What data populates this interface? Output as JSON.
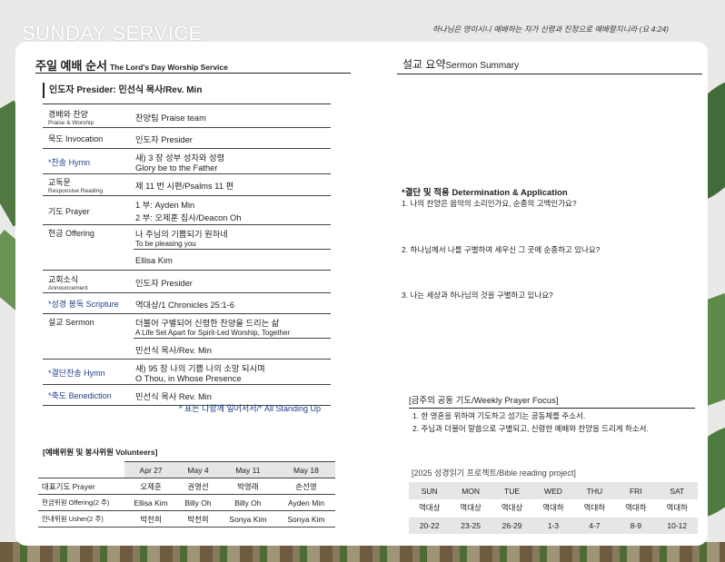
{
  "header": {
    "title": "SUNDAY SERVICE",
    "verse": "하나님은 영이시니 예배하는 자가 신령과 진정으로 예배할지니라 (요 4:24)"
  },
  "order": {
    "title": "주일 예배 순서",
    "title_en": "The Lord's Day Worship Service",
    "presider": "인도자 Presider: 민선식 목사/Rev. Min",
    "rows": [
      {
        "label": "경배와 찬양",
        "sub": "Praise & Worship",
        "value": "찬양팀 Praise team"
      },
      {
        "label": "묵도 Invocation",
        "value": "인도자 Presider"
      },
      {
        "label": "*찬송 Hymn",
        "value": "새) 3 장 성부 성자와 성령",
        "value2": "Glory be to the Father"
      },
      {
        "label": "교독문",
        "sub": "Responsive Reading",
        "value": "제 11 번 시편/Psalms 11 편"
      },
      {
        "label": "기도 Prayer",
        "value": "1 부: Ayden Min",
        "value2": "2 부: 오제훈 집사/Deacon Oh"
      },
      {
        "label": "헌금 Offering",
        "value": "나 주님의 기쁨되기 원하네",
        "value2": "To be pleasing you",
        "value3": "Ellisa Kim"
      },
      {
        "label": "교회소식",
        "sub": "Announcement",
        "value": "인도자 Presider"
      },
      {
        "label": "*성경 봉독 Scripture",
        "value": "역대상/1 Chronicles 25:1-6"
      },
      {
        "label": "설교 Sermon",
        "value": "더불어 구별되어 신령한 찬양을 드리는 삶",
        "value2": "A Life Set Apart for Spirit-Led Worship, Together",
        "value3": "민선식 목사/Rev. Min"
      },
      {
        "label": "*결단찬송 Hymn",
        "value": "새) 95 장 나의 기쁨 나의 소망 되시며",
        "value2": "O Thou, in Whose Presence"
      },
      {
        "label": "*축도 Benediction",
        "value": "민선식 목사 Rev. Min"
      }
    ],
    "standing_note": "* 표는 다함께 일어서서/* All Standing Up"
  },
  "volunteers": {
    "title": "[예배위원 및 봉사위원 Volunteers]",
    "dates": [
      "Apr 27",
      "May 4",
      "May 11",
      "May 18"
    ],
    "rows": [
      {
        "role": "대표기도 Prayer",
        "names": [
          "오제훈",
          "권영선",
          "박영래",
          "손선영"
        ]
      },
      {
        "role": "헌금위원 Offering(2 주)",
        "names": [
          "Ellisa Kim",
          "Billy Oh",
          "Billy Oh",
          "Ayden Min"
        ]
      },
      {
        "role": "안내위원 Usher(2 주)",
        "names": [
          "박천희",
          "박천희",
          "Sonya Kim",
          "Sonya Kim"
        ]
      }
    ]
  },
  "sermon": {
    "title": "설교 요약",
    "title_en": "Sermon Summary",
    "determination_title": "*결단 및 적용 Determination & Application",
    "questions": [
      "1. 나의 찬양은 음악의 소리인가요, 순종의 고백인가요?",
      "2. 하나님께서 나를 구별하여 세우신 그 곳에 순종하고 있나요?",
      "3. 나는 세상과 하나님의 것을 구별하고 있나요?"
    ]
  },
  "prayer": {
    "title": "[금주의 공동 기도/Weekly Prayer Focus]",
    "items": [
      "1. 한 영혼을 위하여 기도하고 섬기는 공동체를 주소서.",
      "2. 주님과 더불어 말씀으로 구별되고, 신령한 예배와 찬양을 드리게 하소서."
    ]
  },
  "bible_reading": {
    "title": "[2025 성경읽기 프로젝트/Bible reading project]",
    "days": [
      "SUN",
      "MON",
      "TUE",
      "WED",
      "THU",
      "FRI",
      "SAT"
    ],
    "books": [
      "역대상",
      "역대상",
      "역대상",
      "역대하",
      "역대하",
      "역대하",
      "역대하"
    ],
    "chapters": [
      "20-22",
      "23-25",
      "26-29",
      "1-3",
      "4-7",
      "8-9",
      "10-12"
    ]
  }
}
